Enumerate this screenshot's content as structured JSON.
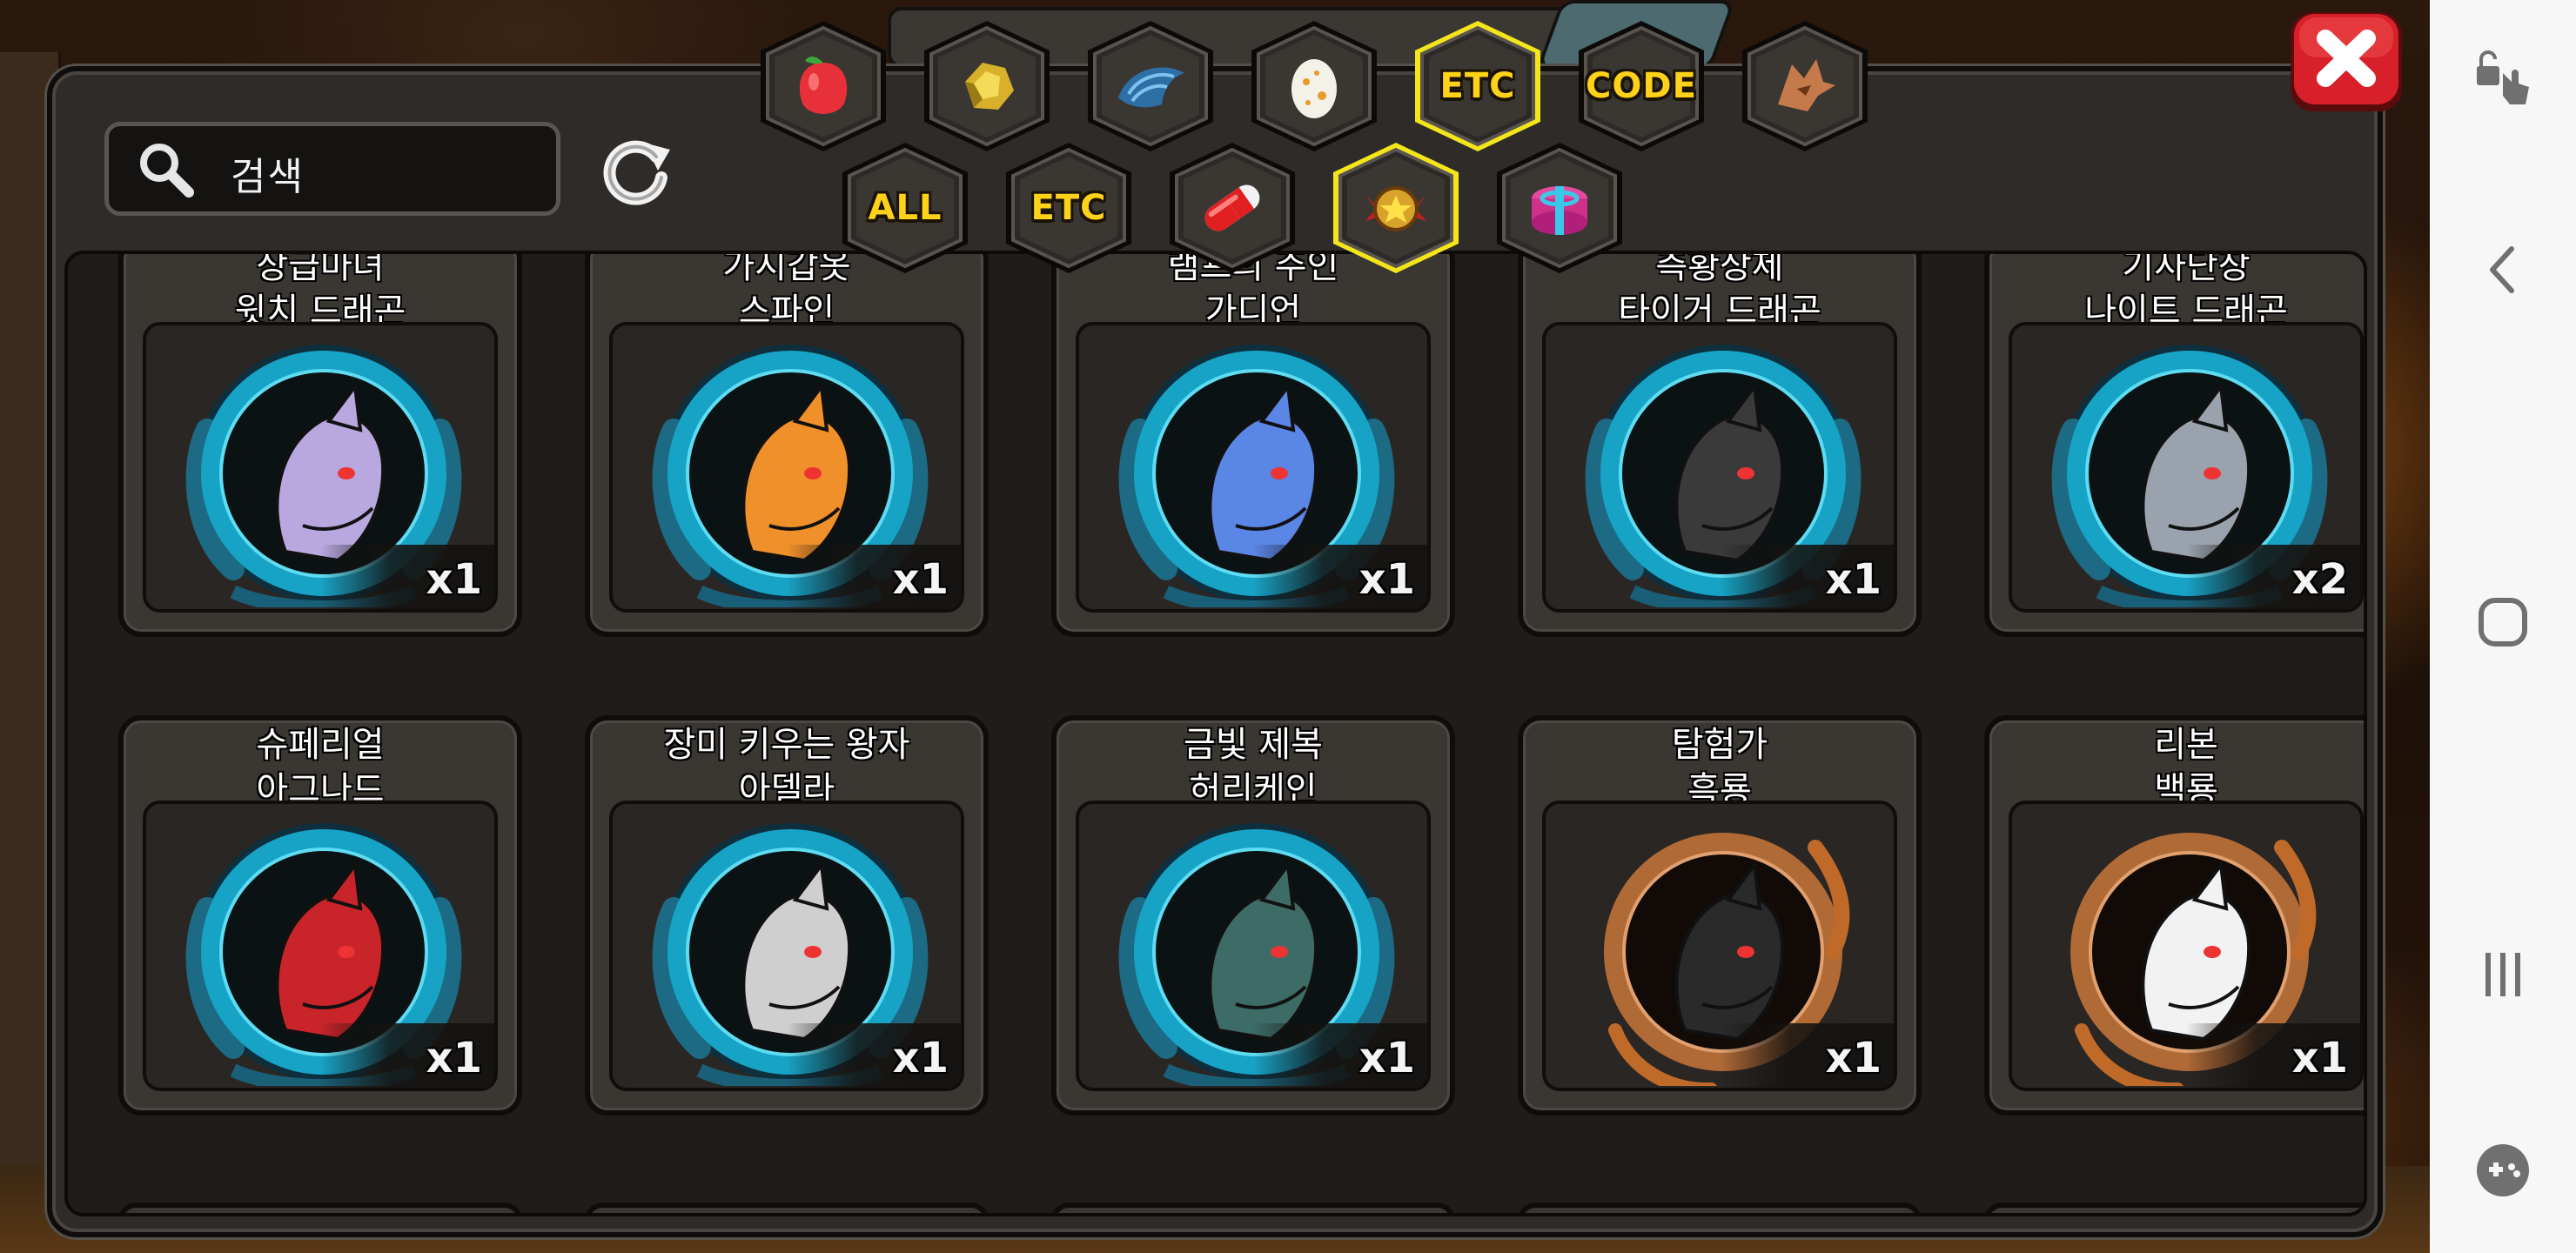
{
  "search": {
    "label": "검색"
  },
  "tabs_top": [
    {
      "label": "",
      "icon": "fruit-icon",
      "selected": false
    },
    {
      "label": "",
      "icon": "gold-ore-icon",
      "selected": false
    },
    {
      "label": "",
      "icon": "scale-icon",
      "selected": false
    },
    {
      "label": "",
      "icon": "egg-icon",
      "selected": false
    },
    {
      "label": "ETC",
      "icon": "",
      "selected": true
    },
    {
      "label": "CODE",
      "icon": "",
      "selected": false
    },
    {
      "label": "",
      "icon": "dragon-head-icon",
      "selected": false
    }
  ],
  "tabs_bottom": [
    {
      "label": "ALL",
      "icon": "",
      "selected": false
    },
    {
      "label": "ETC",
      "icon": "",
      "selected": false
    },
    {
      "label": "",
      "icon": "pill-icon",
      "selected": false
    },
    {
      "label": "",
      "icon": "star-badge-icon",
      "selected": true
    },
    {
      "label": "",
      "icon": "gift-box-icon",
      "selected": false
    }
  ],
  "cards": [
    {
      "title1": "상급마녀",
      "title2": "윗치 드래곤",
      "count": "x1",
      "frame": "blue",
      "color": "#b9a8e0"
    },
    {
      "title1": "가시갑옷",
      "title2": "스파인",
      "count": "x1",
      "frame": "blue",
      "color": "#f0902a"
    },
    {
      "title1": "램프의 주인",
      "title2": "가디언",
      "count": "x1",
      "frame": "blue",
      "color": "#5a86e6"
    },
    {
      "title1": "측황상제",
      "title2": "타이거 드래곤",
      "count": "x1",
      "frame": "blue",
      "color": "#3a3a3a"
    },
    {
      "title1": "기사단장",
      "title2": "나이트 드래곤",
      "count": "x2",
      "frame": "blue",
      "color": "#9aa3ad"
    },
    {
      "title1": "슈페리얼",
      "title2": "아그나드",
      "count": "x1",
      "frame": "blue",
      "color": "#c8242a"
    },
    {
      "title1": "장미 키우는 왕자",
      "title2": "아델라",
      "count": "x1",
      "frame": "blue",
      "color": "#cfcfcf"
    },
    {
      "title1": "금빛 제복",
      "title2": "허리케인",
      "count": "x1",
      "frame": "blue",
      "color": "#3d6b66"
    },
    {
      "title1": "탐험가",
      "title2": "흑룡",
      "count": "x1",
      "frame": "bronze",
      "color": "#2a2a2a"
    },
    {
      "title1": "리본",
      "title2": "백룡",
      "count": "x1",
      "frame": "bronze",
      "color": "#f2f2f2"
    }
  ],
  "colors": {
    "tab_gold": "#ffd21a",
    "selected_border": "#f4e51a",
    "close_red": "#d8202a"
  }
}
